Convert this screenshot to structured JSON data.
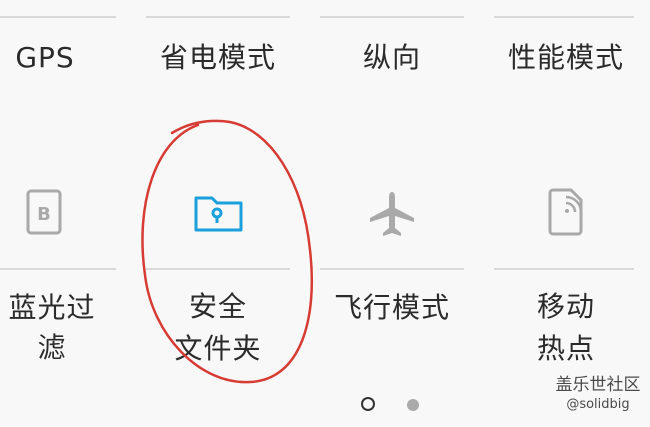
{
  "quick_panel": {
    "row1": [
      {
        "label": "GPS"
      },
      {
        "label": "省电模式"
      },
      {
        "label": "纵向"
      },
      {
        "label": "性能模式"
      }
    ],
    "row2": [
      {
        "label": "蓝光过滤",
        "icon": "blue-light-filter-icon",
        "icon_text": "B"
      },
      {
        "label_line1": "安全",
        "label_line2": "文件夹",
        "icon": "secure-folder-icon"
      },
      {
        "label": "飞行模式",
        "icon": "airplane-icon"
      },
      {
        "label_line1": "移动",
        "label_line2": "热点",
        "icon": "mobile-hotspot-icon"
      }
    ]
  },
  "pager": {
    "pages": 2,
    "current": 1
  },
  "watermark": {
    "line1": "盖乐世社区",
    "line2": "@solidbig"
  },
  "colors": {
    "active": "#1aa1dd",
    "inactive": "#a9a9a9",
    "annotation": "#d63b34"
  }
}
